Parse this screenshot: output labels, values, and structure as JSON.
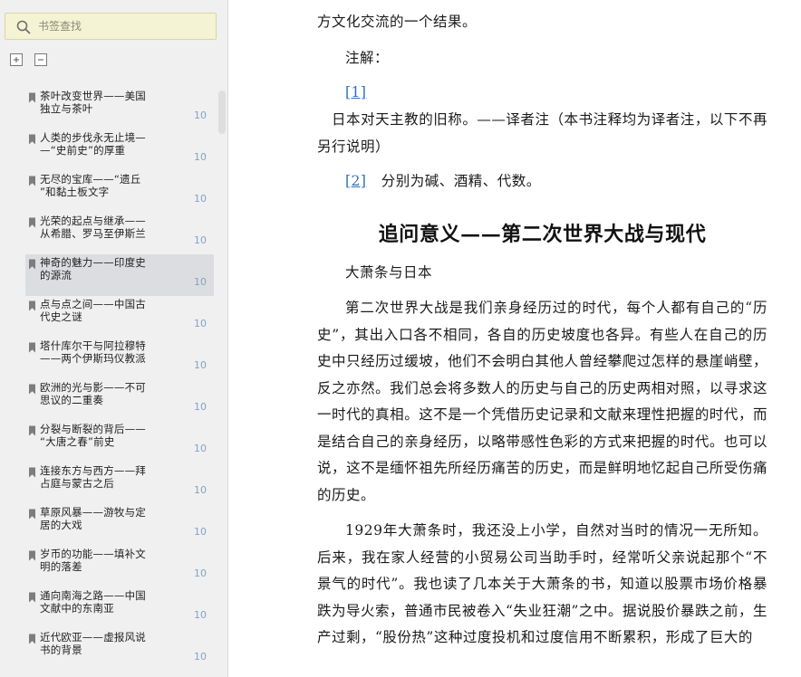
{
  "search": {
    "placeholder": "书签查找"
  },
  "toc": [
    {
      "title": "茶叶改变世界——美国\n独立与茶叶",
      "page": "10"
    },
    {
      "title": "人类的步伐永无止境—\n—“史前史”的厚重",
      "page": "10"
    },
    {
      "title": "无尽的宝库——“遗丘\n”和黏土板文字",
      "page": "10"
    },
    {
      "title": "光荣的起点与继承——\n从希腊、罗马至伊斯兰",
      "page": "10"
    },
    {
      "title": "神奇的魅力——印度史\n的源流",
      "page": "10",
      "active": true
    },
    {
      "title": "点与点之间——中国古\n代史之谜",
      "page": "10"
    },
    {
      "title": "塔什库尔干与阿拉穆特\n——两个伊斯玛仪教派",
      "page": "10"
    },
    {
      "title": "欧洲的光与影——不可\n思议的二重奏",
      "page": "10"
    },
    {
      "title": "分裂与断裂的背后——\n“大唐之春”前史",
      "page": "10"
    },
    {
      "title": "连接东方与西方——拜\n占庭与蒙古之后",
      "page": "10"
    },
    {
      "title": "草原风暴——游牧与定\n居的大戏",
      "page": "10"
    },
    {
      "title": "岁币的功能——填补文\n明的落差",
      "page": "10"
    },
    {
      "title": "通向南海之路——中国\n文献中的东南亚",
      "page": "10"
    },
    {
      "title": "近代欧亚——虚报风说\n书的背景",
      "page": "10"
    }
  ],
  "content": {
    "top_line": "方文化交流的一个结果。",
    "notes_label": "注解：",
    "note1_ref": "[1]",
    "note1_text": "日本对天主教的旧称。——译者注（本书注释均为译者注，以下不再另行说明）",
    "note2_ref": "[2]",
    "note2_text": "分别为碱、酒精、代数。",
    "chapter_title": "追问意义——第二次世界大战与现代",
    "section_title": "大萧条与日本",
    "para1": "第二次世界大战是我们亲身经历过的时代，每个人都有自己的“历史”，其出入口各不相同，各自的历史坡度也各异。有些人在自己的历史中只经历过缓坡，他们不会明白其他人曾经攀爬过怎样的悬崖峭壁，反之亦然。我们总会将多数人的历史与自己的历史两相对照，以寻求这一时代的真相。这不是一个凭借历史记录和文献来理性把握的时代，而是结合自己的亲身经历，以略带感性色彩的方式来把握的时代。也可以说，这不是缅怀祖先所经历痛苦的历史，而是鲜明地忆起自己所受伤痛的历史。",
    "para2": "1929年大萧条时，我还没上小学，自然对当时的情况一无所知。后来，我在家人经营的小贸易公司当助手时，经常听父亲说起那个“不景气的时代”。我也读了几本关于大萧条的书，知道以股票市场价格暴跌为导火索，普通市民被卷入“失业狂潮”之中。据说股价暴跌之前，生产过剩，“股份热”这种过度投机和过度信用不断累积，形成了巨大的"
  }
}
